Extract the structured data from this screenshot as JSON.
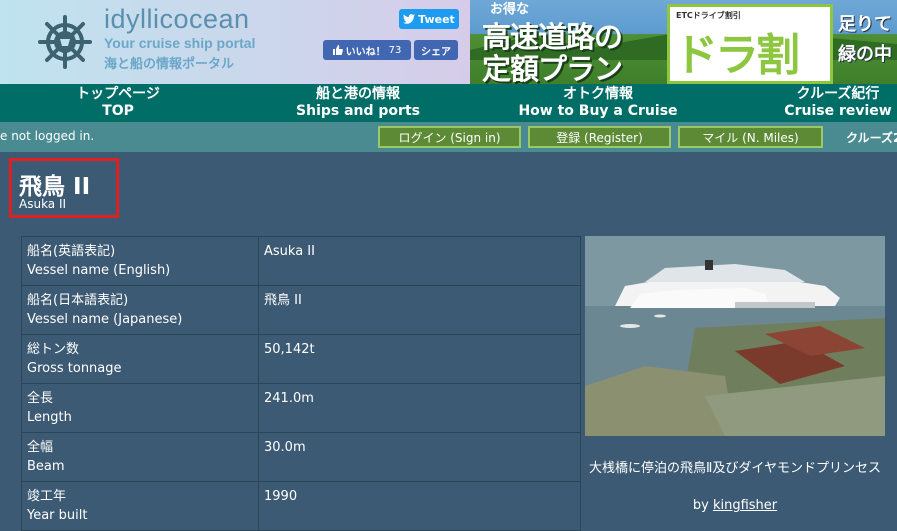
{
  "header": {
    "brand": "idyllicocean",
    "tagline_en": "Your cruise ship portal",
    "tagline_jp": "海と船の情報ポータル"
  },
  "social": {
    "tweet_label": "Tweet",
    "like_label": "いいね！",
    "like_count": "73",
    "share_label": "シェア"
  },
  "banner": {
    "deal_text": "お得な",
    "line1": "高速道路の",
    "line2": "定額プラン",
    "etc_text": "ETCドライブ割引",
    "dora_text": "ドラ割",
    "right1": "足りて",
    "right2": "緑の中"
  },
  "nav": {
    "items": [
      {
        "jp": "トップページ",
        "en": "TOP"
      },
      {
        "jp": "船と港の情報",
        "en": "Ships and ports"
      },
      {
        "jp": "オトク情報",
        "en": "How to Buy a Cruise"
      },
      {
        "jp": "クルーズ紀行",
        "en": "Cruise review"
      }
    ]
  },
  "status": {
    "login_state": "e not logged in.",
    "sign_in": "ログイン (Sign in)",
    "register": "登録 (Register)",
    "miles": "マイル (N. Miles)",
    "truncated": "クルーズ2"
  },
  "ship": {
    "name_jp": "飛鳥 II",
    "name_en": "Asuka II"
  },
  "specs": [
    {
      "label_jp": "船名(英語表記)",
      "label_en": "Vessel name (English)",
      "value": "Asuka II"
    },
    {
      "label_jp": "船名(日本語表記)",
      "label_en": "Vessel name (Japanese)",
      "value": "飛鳥 II"
    },
    {
      "label_jp": "総トン数",
      "label_en": "Gross tonnage",
      "value": "50,142t"
    },
    {
      "label_jp": "全長",
      "label_en": "Length",
      "value": "241.0m"
    },
    {
      "label_jp": "全幅",
      "label_en": "Beam",
      "value": "30.0m"
    },
    {
      "label_jp": "竣工年",
      "label_en": "Year built",
      "value": "1990"
    }
  ],
  "photo": {
    "caption": "大桟橋に停泊の飛鳥Ⅱ及びダイヤモンドプリンセス",
    "by_label": "by",
    "author": "kingfisher"
  },
  "colors": {
    "page_bg": "#3c5a73",
    "nav_bg": "#006e66",
    "status_bg": "#4a8b91",
    "button_bg": "#5c8a35",
    "highlight": "#e02020"
  }
}
